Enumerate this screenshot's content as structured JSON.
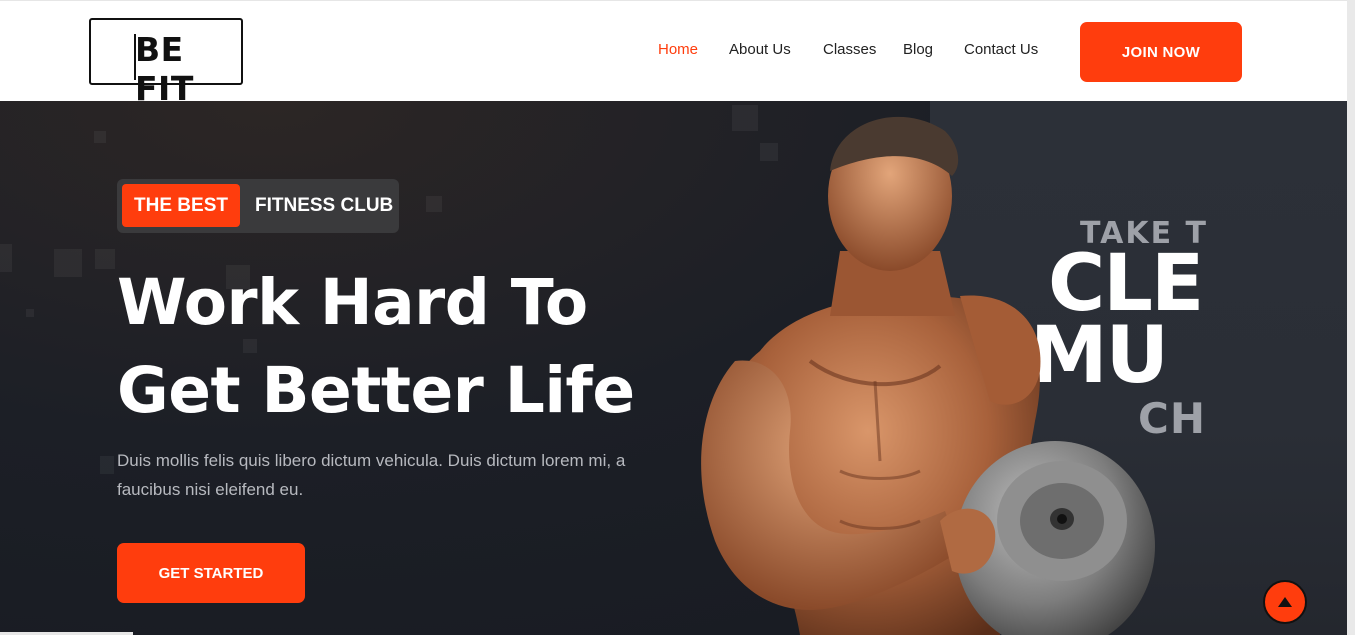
{
  "brand": {
    "logo_text": "BE FIT"
  },
  "nav": {
    "items": [
      {
        "label": "Home",
        "active": true
      },
      {
        "label": "About Us",
        "active": false
      },
      {
        "label": "Classes",
        "active": false
      },
      {
        "label": "Blog",
        "active": false
      },
      {
        "label": "Contact Us",
        "active": false
      }
    ],
    "cta_label": "JOIN NOW"
  },
  "hero": {
    "badge_highlight": "THE BEST",
    "badge_text": "FITNESS CLUB",
    "headline_line1": "Work Hard To",
    "headline_line2": "Get Better Life",
    "description": "Duis mollis felis quis libero dictum vehicula. Duis dictum lorem mi, a faucibus nisi eleifend eu.",
    "cta_label": "GET STARTED"
  },
  "promo": {
    "line1": "TAKE T",
    "line2": "CLE",
    "line3": "MU",
    "line4": "CH"
  },
  "icons": {
    "scroll_top": "arrow-up-icon",
    "hero_image": "bodybuilder-dumbbell-icon"
  },
  "colors": {
    "accent": "#ff3d0d",
    "dark_bg": "#1b1e25",
    "header_bg": "#ffffff",
    "nav_text": "#222222"
  }
}
